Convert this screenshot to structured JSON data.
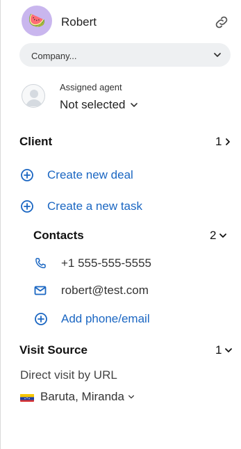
{
  "contact": {
    "name": "Robert",
    "avatar_emoji": "🍉"
  },
  "company": {
    "placeholder": "Company..."
  },
  "agent": {
    "label": "Assigned agent",
    "value": "Not selected"
  },
  "client": {
    "title": "Client",
    "count": "1"
  },
  "actions": {
    "create_deal": "Create new deal",
    "create_task": "Create a new task"
  },
  "contacts": {
    "title": "Contacts",
    "count": "2",
    "phone": "+1 555-555-5555",
    "email": "robert@test.com",
    "add_label": "Add phone/email"
  },
  "visit_source": {
    "title": "Visit Source",
    "count": "1",
    "description": "Direct visit by URL",
    "location": "Baruta, Miranda"
  },
  "colors": {
    "accent": "#1a66c2",
    "avatar_bg": "#c9b6ee",
    "pill_bg": "#eef0f2"
  },
  "icons": {
    "link": "link-icon",
    "chevron": "chevron-down-icon",
    "plus": "plus-circle-icon",
    "phone": "phone-icon",
    "email": "mail-icon",
    "flag": "venezuela-flag-icon"
  }
}
